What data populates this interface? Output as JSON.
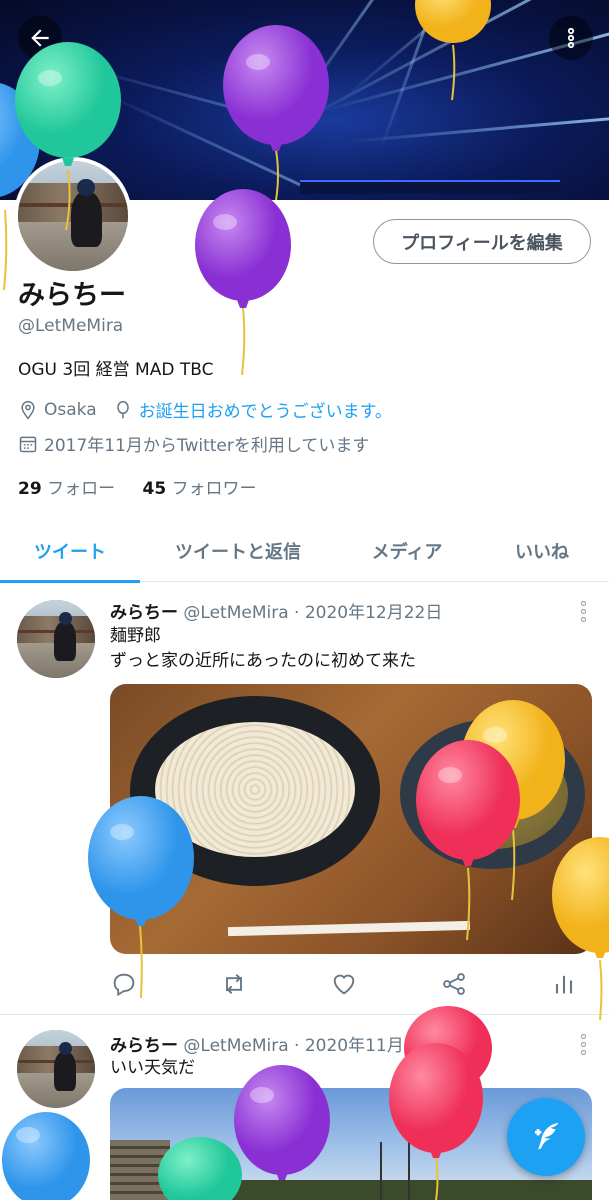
{
  "profile": {
    "name": "みらちー",
    "handle": "@LetMeMira",
    "bio": "OGU 3回 経営 MAD TBC",
    "location": "Osaka",
    "birthday": "お誕生日おめでとうございます。",
    "joined": "2017年11月からTwitterを利用しています",
    "following_count": "29",
    "following_label": "フォロー",
    "followers_count": "45",
    "followers_label": "フォロワー",
    "edit_button": "プロフィールを編集"
  },
  "tabs": [
    {
      "label": "ツイート"
    },
    {
      "label": "ツイートと返信"
    },
    {
      "label": "メディア"
    },
    {
      "label": "いいね"
    }
  ],
  "tweets": [
    {
      "name": "みらちー",
      "meta": "@LetMeMira · 2020年12月22日",
      "line1": "麺野郎",
      "line2": "ずっと家の近所にあったのに初めて来た"
    },
    {
      "name": "みらちー",
      "meta": "@LetMeMira · 2020年11月15日",
      "line1": "いい天気だ"
    }
  ],
  "icons": {
    "back": "arrow-left-icon",
    "more": "more-vertical-icon",
    "location": "location-pin-icon",
    "balloon": "balloon-icon",
    "calendar": "calendar-icon",
    "reply": "reply-icon",
    "retweet": "retweet-icon",
    "like": "heart-icon",
    "share": "share-icon",
    "analytics": "analytics-icon",
    "compose": "compose-tweet-icon"
  },
  "colors": {
    "accent": "#1da1f2",
    "muted": "#657786"
  }
}
